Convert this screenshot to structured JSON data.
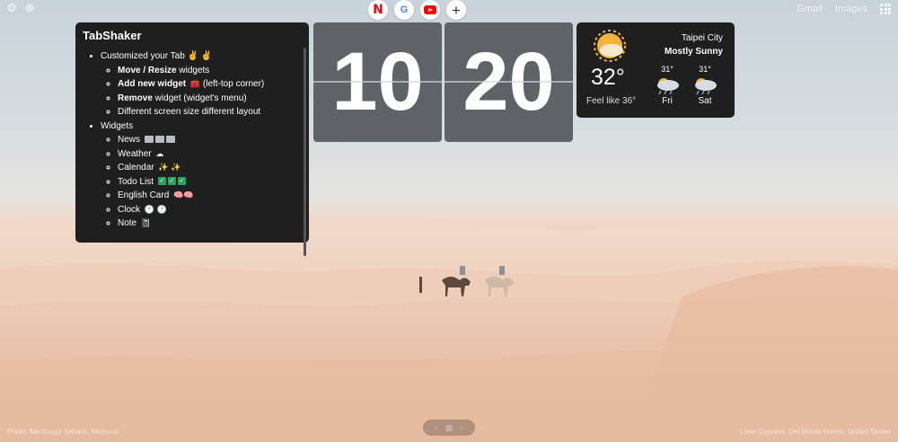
{
  "top_left": {
    "settings_icon": "gear-icon",
    "add_icon": "plus-icon"
  },
  "top_right": {
    "gmail": "Gmail",
    "images": "Images",
    "apps_icon": "apps-grid-icon"
  },
  "shortcuts": [
    {
      "name": "netflix",
      "glyph": "N"
    },
    {
      "name": "google",
      "glyph": "G"
    },
    {
      "name": "youtube",
      "glyph": ""
    },
    {
      "name": "add-shortcut",
      "glyph": "+"
    }
  ],
  "tabshaker": {
    "title": "TabShaker",
    "item1": "Customized your Tab ✌️ ✌️",
    "sub1_bold": "Move / Resize",
    "sub1_rest": " widgets",
    "sub2_bold": "Add new widget",
    "sub2_rest": " (left-top corner)",
    "sub3_bold": "Remove",
    "sub3_rest": " widget (widget's menu)",
    "sub4": "Different screen size different layout",
    "item2": "Widgets",
    "widgets": {
      "news": "News",
      "weather": "Weather",
      "calendar": "Calendar",
      "todo": "Todo List",
      "english": "English Card",
      "clock": "Clock",
      "note": "Note"
    }
  },
  "clock": {
    "hours": "10",
    "minutes": "20"
  },
  "weather": {
    "city": "Taipei City",
    "condition": "Mostly Sunny",
    "temp": "32°",
    "feel": "Feel like 36°",
    "forecast": [
      {
        "temp": "31°",
        "day": "Fri"
      },
      {
        "temp": "31°",
        "day": "Sat"
      }
    ]
  },
  "credits": {
    "left": "Photo: Merzouga Sahara, Morocco",
    "right": "Lone Cypress, Del Monte Forest, United States"
  },
  "pager": {
    "prev": "‹",
    "grid": "▦",
    "next": "›"
  }
}
